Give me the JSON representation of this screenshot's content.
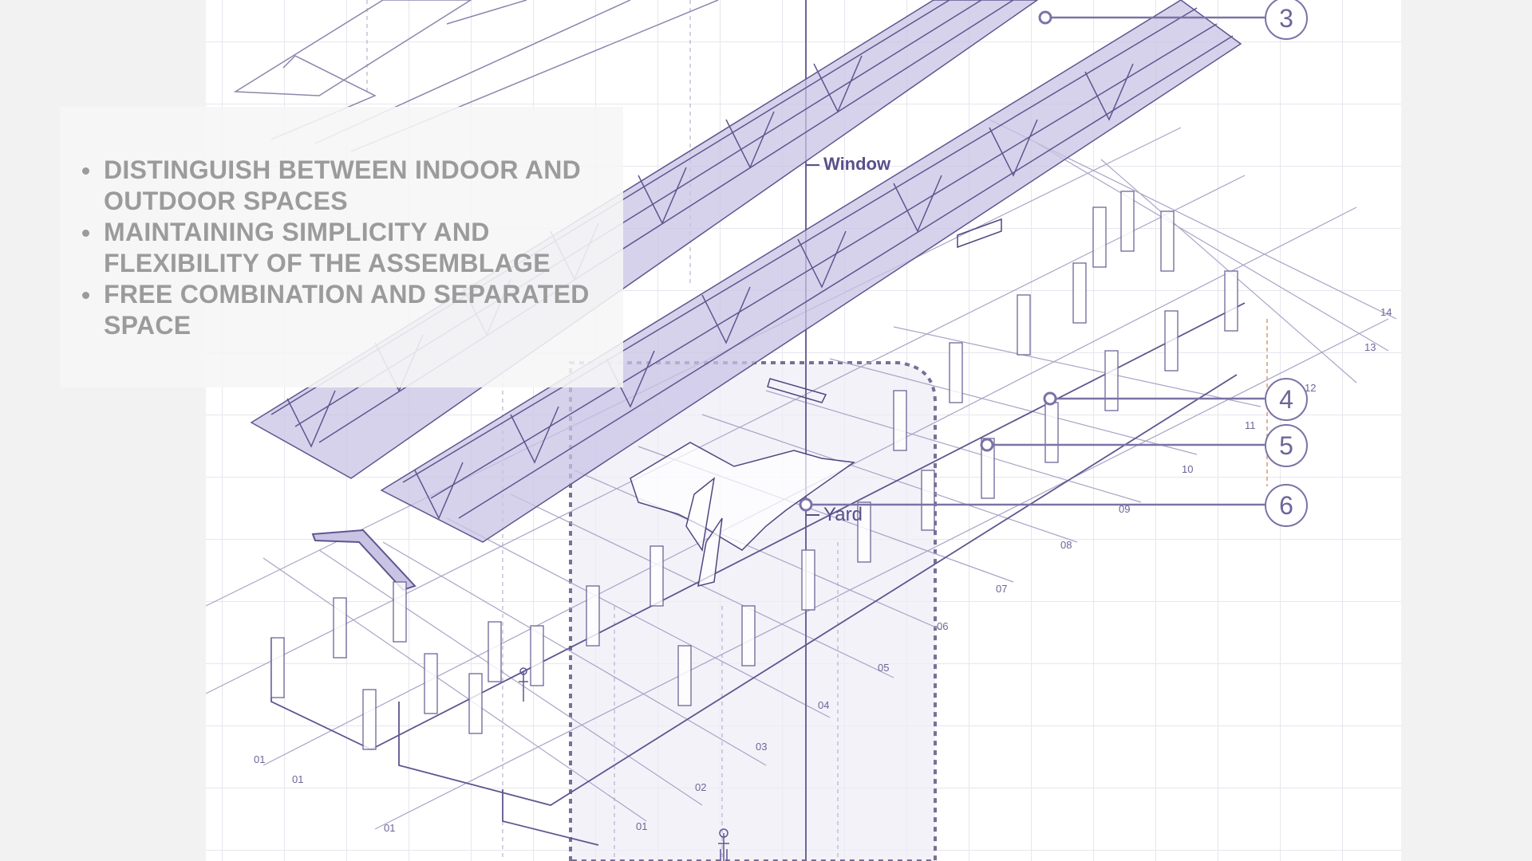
{
  "bullets": [
    "DISTINGUISH BETWEEN INDOOR AND OUTDOOR SPACES",
    "MAINTAINING SIMPLICITY AND FLEXIBILITY OF THE ASSEMBLAGE",
    "FREE COMBINATION AND SEPARATED SPACE"
  ],
  "labels": {
    "window": "Window",
    "yard": "Yard"
  },
  "callouts": [
    "3",
    "4",
    "5",
    "6"
  ],
  "axis_labels": [
    "01",
    "01",
    "01",
    "01",
    "02",
    "03",
    "04",
    "05",
    "06",
    "07",
    "08",
    "09",
    "10",
    "11",
    "12",
    "13",
    "14"
  ],
  "colors": {
    "line": "#6d6697",
    "roof_fill": "#c9c3e4",
    "yard_fill": "#eeecf7",
    "text": "#9b9b9b"
  }
}
